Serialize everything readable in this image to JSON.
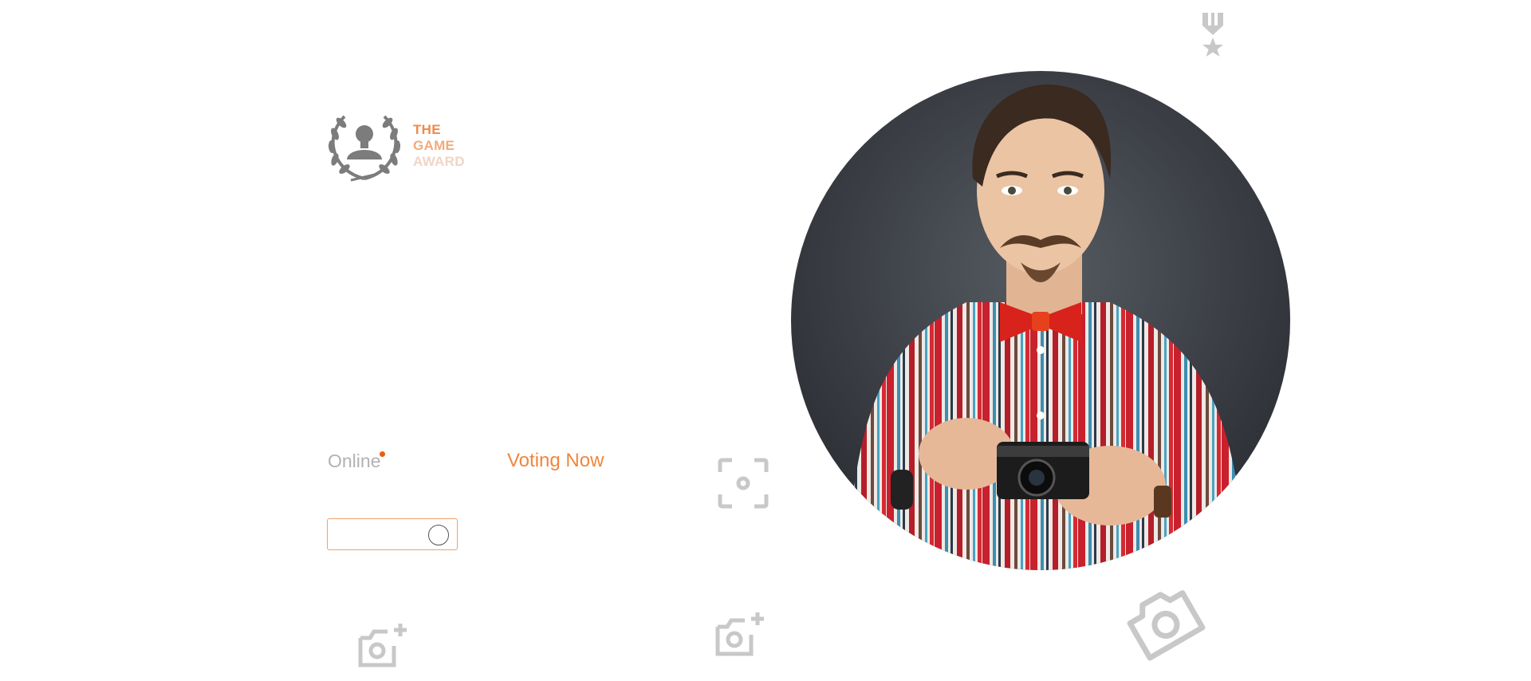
{
  "logo": {
    "line1": "THE",
    "line2": "GAME",
    "line3": "AWARD",
    "icon": "laurel-avatar-icon"
  },
  "status": {
    "online_label": "Online",
    "voting_label": "Voting Now"
  },
  "icons": {
    "medal": "medal-star-icon",
    "focus": "camera-focus-icon",
    "add_photo_1": "add-photo-icon",
    "add_photo_2": "add-photo-icon",
    "camera_tilted": "camera-tilted-icon"
  },
  "colors": {
    "accent": "#f0863e",
    "muted": "#b2b2b2",
    "icon_gray": "#c8c8c8",
    "dot": "#ec5a16"
  },
  "portrait": {
    "description_icon": "portrait-photo"
  }
}
